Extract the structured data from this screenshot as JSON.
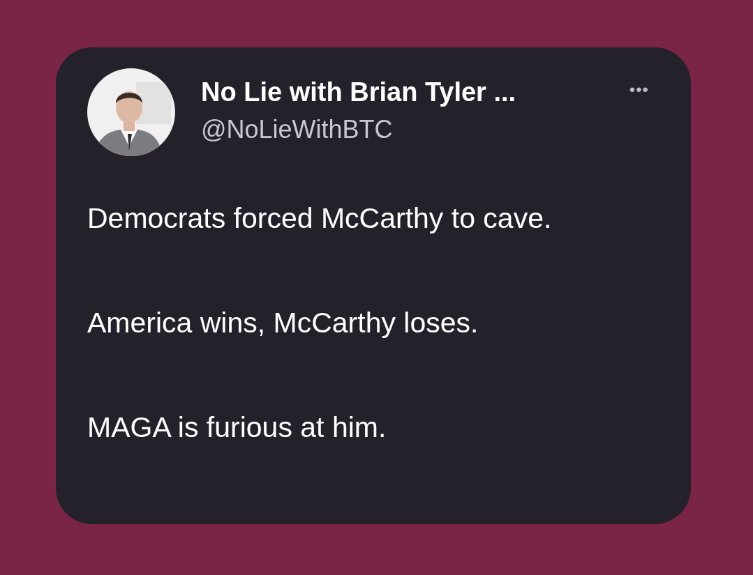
{
  "post": {
    "author": {
      "name": "No Lie with Brian Tyler ...",
      "handle": "@NoLieWithBTC"
    },
    "more_menu": {
      "label": "•••"
    },
    "paragraphs": [
      "Democrats forced McCarthy to cave.",
      "America wins, McCarthy loses.",
      "MAGA is furious at him."
    ]
  }
}
